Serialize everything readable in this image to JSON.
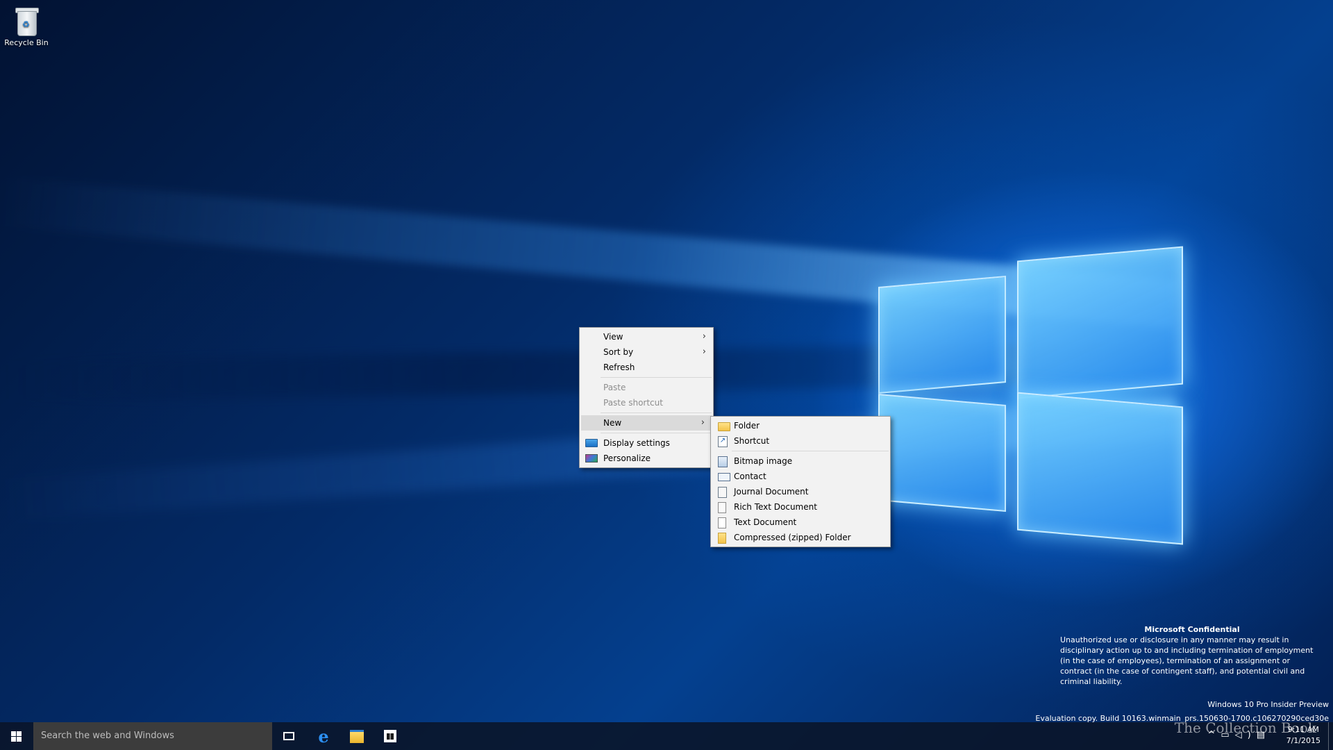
{
  "desktop": {
    "icons": [
      {
        "label": "Recycle Bin",
        "icon": "recycle-bin-icon"
      }
    ]
  },
  "context_menu": {
    "items": [
      {
        "label": "View",
        "submenu": true
      },
      {
        "label": "Sort by",
        "submenu": true
      },
      {
        "label": "Refresh"
      },
      {
        "label": "Paste",
        "disabled": true
      },
      {
        "label": "Paste shortcut",
        "disabled": true
      },
      {
        "label": "New",
        "submenu": true,
        "highlighted": true
      },
      {
        "label": "Display settings",
        "icon": "display-settings-icon"
      },
      {
        "label": "Personalize",
        "icon": "personalize-icon"
      }
    ]
  },
  "new_submenu": {
    "items": [
      {
        "label": "Folder",
        "icon": "folder-icon"
      },
      {
        "label": "Shortcut",
        "icon": "shortcut-icon"
      },
      {
        "label": "Bitmap image",
        "icon": "bitmap-icon"
      },
      {
        "label": "Contact",
        "icon": "contact-icon"
      },
      {
        "label": "Journal Document",
        "icon": "journal-icon"
      },
      {
        "label": "Rich Text Document",
        "icon": "rich-text-icon"
      },
      {
        "label": "Text Document",
        "icon": "text-document-icon"
      },
      {
        "label": "Compressed (zipped) Folder",
        "icon": "zip-folder-icon"
      }
    ]
  },
  "confidential": {
    "title": "Microsoft Confidential",
    "body": "Unauthorized use or disclosure in any manner may result in disciplinary action up to and including termination of employment (in the case of employees), termination of an assignment or contract (in the case of contingent staff), and potential civil and criminal liability."
  },
  "build": {
    "edition": "Windows 10 Pro Insider Preview",
    "evaluation": "Evaluation copy. Build 10163.winmain_prs.150630-1700.c106270290ced30e"
  },
  "taskbar": {
    "search_placeholder": "Search the web and Windows",
    "time": "9:11 AM",
    "date": "7/1/2015"
  },
  "watermark": "The Collection Book",
  "colors": {
    "accent": "#0078d7",
    "menu_bg": "#f2f2f2",
    "menu_highlight": "#dadada",
    "taskbar": "#0a1428"
  }
}
